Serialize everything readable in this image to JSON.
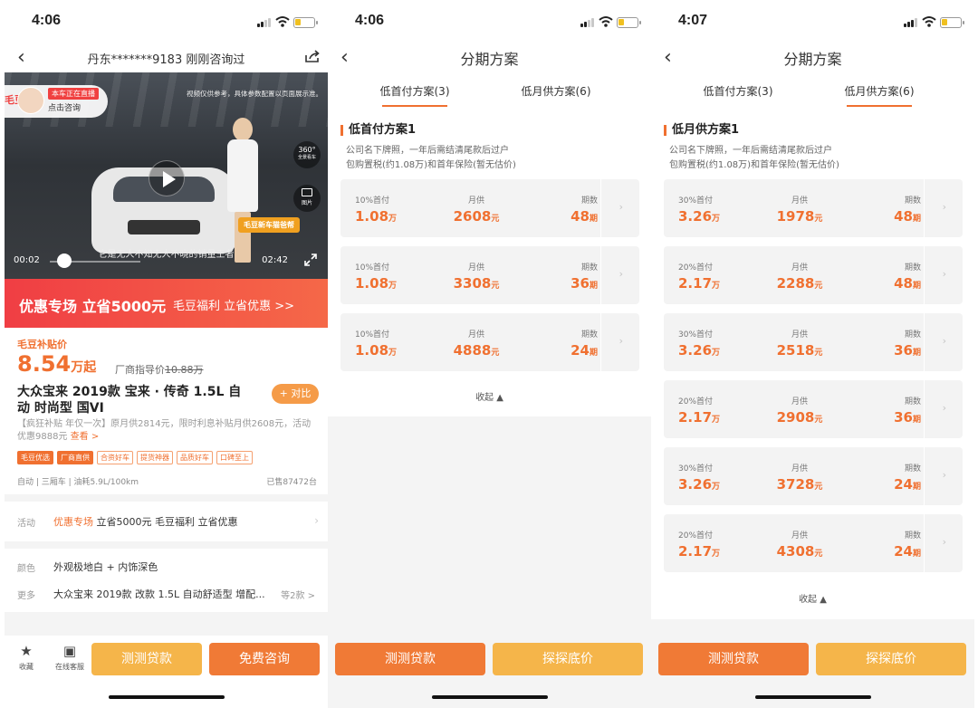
{
  "panels": [
    {
      "status": {
        "time": "4:06"
      },
      "nav": {
        "title": "丹东*******9183 刚刚咨询过"
      },
      "video": {
        "logo": "毛豆",
        "live_tag": "本车正在直播",
        "consult": "点击咨询",
        "notice": "视频仅供参考，具体参数配置以页面展示准。",
        "v360": "360°",
        "v360_sub": "全景看车",
        "pics": "图片",
        "banner": "毛豆新车猫爸帮",
        "caption": "它是无人不知无人不晓的销量王者",
        "time_start": "00:02",
        "time_end": "02:42"
      },
      "promo": {
        "main": "优惠专场 立省5000元",
        "sub": "毛豆福利 立省优惠 >>"
      },
      "price": {
        "label": "毛豆补贴价",
        "value": "8.54",
        "unit": "万起",
        "guide_label": "厂商指导价",
        "guide_value": "10.88万"
      },
      "car_name": "大众宝来 2019款 宝来 · 传奇 1.5L 自动 时尚型 国VI",
      "compare": "+ 对比",
      "desc": "【疯狂补贴 年仅一次】原月供2814元，限时利息补贴月供2608元，活动优惠9888元",
      "desc_more": "查看 >",
      "tags": [
        "毛豆优选",
        "厂商直供",
        "合资好车",
        "提货神器",
        "品质好车",
        "口碑至上"
      ],
      "specs": "自动 | 三厢车 | 油耗5.9L/100km",
      "sold": "已售87472台",
      "activity": {
        "label": "活动",
        "highlight": "优惠专场",
        "text": "立省5000元 毛豆福利 立省优惠"
      },
      "color": {
        "label": "颜色",
        "text": "外观极地白 + 内饰深色"
      },
      "more": {
        "label": "更多",
        "text": "大众宝来 2019款 改款 1.5L 自动舒适型 增配...",
        "extra": "等2款 >"
      },
      "bottom": {
        "fav_label": "收藏",
        "service_label": "在线客服",
        "btn_loan": "测测贷款",
        "btn_consult": "免费咨询"
      }
    },
    {
      "status": {
        "time": "4:06"
      },
      "nav": {
        "title": "分期方案"
      },
      "tabs": [
        "低首付方案(3)",
        "低月供方案(6)"
      ],
      "active_tab": 0,
      "plan_title": "低首付方案1",
      "plan_desc_1": "公司名下牌照，一年后需结清尾款后过户",
      "plan_desc_2": "包购置税(约1.08万)和首年保险(暂无估价)",
      "cards": [
        {
          "down_label": "10%首付",
          "down": "1.08",
          "down_unit": "万",
          "monthly_label": "月供",
          "monthly": "2608",
          "monthly_unit": "元",
          "term_label": "期数",
          "term": "48",
          "term_unit": "期"
        },
        {
          "down_label": "10%首付",
          "down": "1.08",
          "down_unit": "万",
          "monthly_label": "月供",
          "monthly": "3308",
          "monthly_unit": "元",
          "term_label": "期数",
          "term": "36",
          "term_unit": "期"
        },
        {
          "down_label": "10%首付",
          "down": "1.08",
          "down_unit": "万",
          "monthly_label": "月供",
          "monthly": "4888",
          "monthly_unit": "元",
          "term_label": "期数",
          "term": "24",
          "term_unit": "期"
        }
      ],
      "collapse": "收起 ▲",
      "bottom": {
        "btn_loan": "测测贷款",
        "btn_price": "探探底价"
      }
    },
    {
      "status": {
        "time": "4:07"
      },
      "nav": {
        "title": "分期方案"
      },
      "tabs": [
        "低首付方案(3)",
        "低月供方案(6)"
      ],
      "active_tab": 1,
      "plan_title": "低月供方案1",
      "plan_desc_1": "公司名下牌照，一年后需结清尾款后过户",
      "plan_desc_2": "包购置税(约1.08万)和首年保险(暂无估价)",
      "cards": [
        {
          "down_label": "30%首付",
          "down": "3.26",
          "down_unit": "万",
          "monthly_label": "月供",
          "monthly": "1978",
          "monthly_unit": "元",
          "term_label": "期数",
          "term": "48",
          "term_unit": "期"
        },
        {
          "down_label": "20%首付",
          "down": "2.17",
          "down_unit": "万",
          "monthly_label": "月供",
          "monthly": "2288",
          "monthly_unit": "元",
          "term_label": "期数",
          "term": "48",
          "term_unit": "期"
        },
        {
          "down_label": "30%首付",
          "down": "3.26",
          "down_unit": "万",
          "monthly_label": "月供",
          "monthly": "2518",
          "monthly_unit": "元",
          "term_label": "期数",
          "term": "36",
          "term_unit": "期"
        },
        {
          "down_label": "20%首付",
          "down": "2.17",
          "down_unit": "万",
          "monthly_label": "月供",
          "monthly": "2908",
          "monthly_unit": "元",
          "term_label": "期数",
          "term": "36",
          "term_unit": "期"
        },
        {
          "down_label": "30%首付",
          "down": "3.26",
          "down_unit": "万",
          "monthly_label": "月供",
          "monthly": "3728",
          "monthly_unit": "元",
          "term_label": "期数",
          "term": "24",
          "term_unit": "期"
        },
        {
          "down_label": "20%首付",
          "down": "2.17",
          "down_unit": "万",
          "monthly_label": "月供",
          "monthly": "4308",
          "monthly_unit": "元",
          "term_label": "期数",
          "term": "24",
          "term_unit": "期"
        }
      ],
      "collapse": "收起 ▲",
      "bottom": {
        "btn_loan": "测测贷款",
        "btn_price": "探探底价"
      }
    }
  ],
  "colors": {
    "accent": "#f07030",
    "promo": "#f03e44",
    "button_light": "#f5b54a",
    "button_dark": "#f07a36"
  }
}
